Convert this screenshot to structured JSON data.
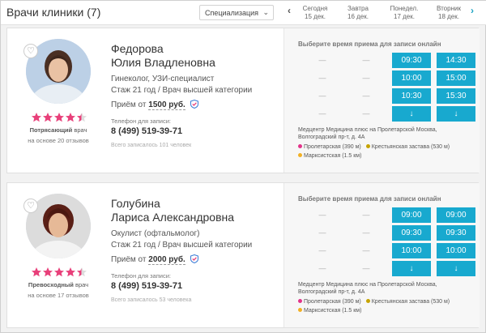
{
  "header": {
    "title": "Врачи клиники (7)",
    "specialization_select": "Специализация",
    "days": [
      {
        "label": "Сегодня",
        "date": "15 дек."
      },
      {
        "label": "Завтра",
        "date": "16 дек."
      },
      {
        "label": "Понедел.",
        "date": "17 дек."
      },
      {
        "label": "Вторник",
        "date": "18 дек."
      }
    ]
  },
  "doctors": [
    {
      "last_name": "Федорова",
      "first_name": "Юлия Владленовна",
      "specialty": "Гинеколог, УЗИ-специалист",
      "experience": "Стаж 21 год / Врач высшей категории",
      "price_prefix": "Приём от",
      "price": "1500 руб.",
      "rating_stars": 4.5,
      "rating_word": "Потрясающий",
      "rating_suffix": " врач",
      "reviews": "на основе 20 отзывов",
      "phone_label": "Телефон для записи:",
      "phone": "8 (499) 519-39-71",
      "total": "Всего записалось 101 человек",
      "schedule": {
        "title": "Выберите время приема для записи онлайн",
        "col1": [
          "—",
          "—",
          "—",
          "—"
        ],
        "col2": [
          "—",
          "—",
          "—",
          "—"
        ],
        "col3": [
          "09:30",
          "10:00",
          "10:30",
          "↓"
        ],
        "col4": [
          "14:30",
          "15:00",
          "15:30",
          "↓"
        ],
        "clinic": "Медцентр Медицина плюс на Пролетарской Москва, Волгоградский пр-т, д. 4А",
        "metro": [
          {
            "name": "Пролетарская (390 м)",
            "color": "#e2338a"
          },
          {
            "name": "Крестьянская застава (530 м)",
            "color": "#c6a300"
          },
          {
            "name": "Марксистская (1.5 км)",
            "color": "#f2b024"
          }
        ]
      }
    },
    {
      "last_name": "Голубина",
      "first_name": "Лариса Александровна",
      "specialty": "Окулист (офтальмолог)",
      "experience": "Стаж 21 год / Врач высшей категории",
      "price_prefix": "Приём от",
      "price": "2000 руб.",
      "rating_stars": 4.5,
      "rating_word": "Превосходный",
      "rating_suffix": " врач",
      "reviews": "на основе 17 отзывов",
      "phone_label": "Телефон для записи:",
      "phone": "8 (499) 519-39-71",
      "total": "Всего записалось 53 человека",
      "schedule": {
        "title": "Выберите время приема для записи онлайн",
        "col1": [
          "—",
          "—",
          "—",
          "—"
        ],
        "col2": [
          "—",
          "—",
          "—",
          "—"
        ],
        "col3": [
          "09:00",
          "09:30",
          "10:00",
          "↓"
        ],
        "col4": [
          "09:00",
          "09:30",
          "10:00",
          "↓"
        ],
        "clinic": "Медцентр Медицина плюс на Пролетарской Москва, Волгоградский пр-т, д. 4А",
        "metro": [
          {
            "name": "Пролетарская (390 м)",
            "color": "#e2338a"
          },
          {
            "name": "Крестьянская застава (530 м)",
            "color": "#c6a300"
          },
          {
            "name": "Марксистская (1.5 км)",
            "color": "#f2b024"
          }
        ]
      }
    }
  ],
  "colors": {
    "slot": "#18a9cf",
    "star": "#e8407a",
    "accent_arrow": "#1aa3c3"
  }
}
